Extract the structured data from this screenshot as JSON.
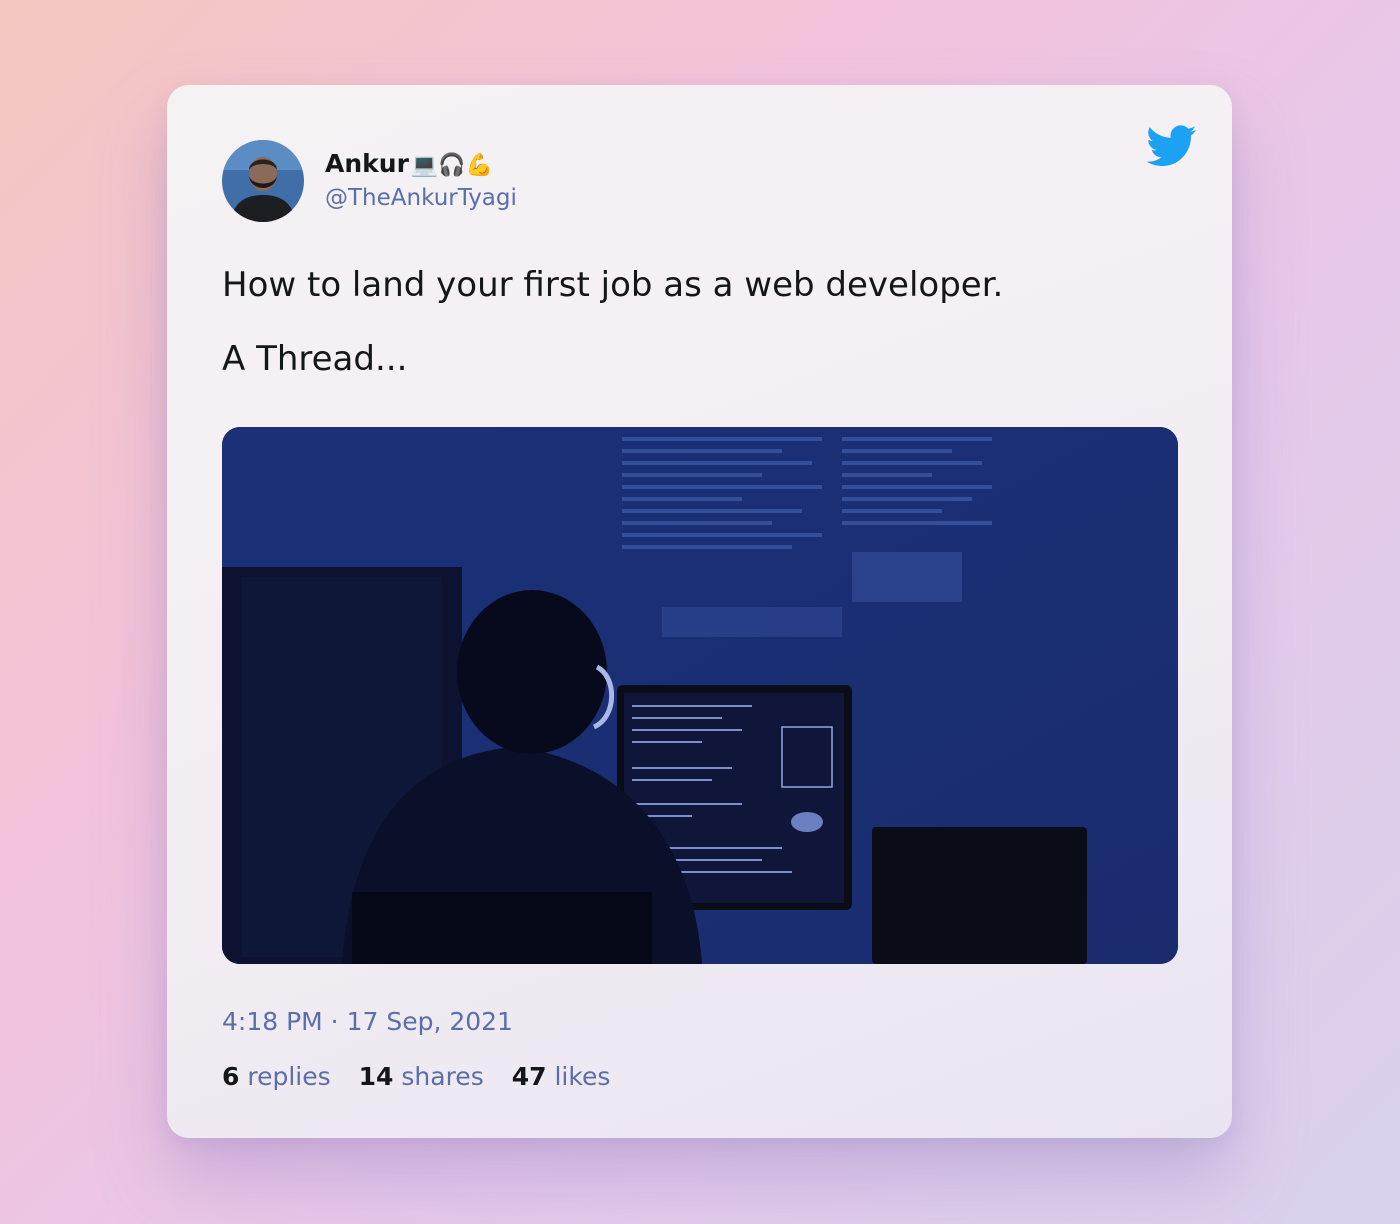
{
  "tweet": {
    "author_name": "Ankur",
    "author_emojis": "💻🎧💪",
    "author_handle": "@TheAnkurTyagi",
    "text_line_1": "How to land your first job as a web developer.",
    "text_line_2": "A Thread...",
    "timestamp": "4:18 PM · 17 Sep, 2021",
    "stats": {
      "replies_count": "6",
      "replies_label": "replies",
      "shares_count": "14",
      "shares_label": "shares",
      "likes_count": "47",
      "likes_label": "likes"
    }
  },
  "icons": {
    "brand": "twitter-bird-icon",
    "brand_color": "#1da1f2"
  },
  "colors": {
    "handle": "#5a6ea8",
    "text": "#14171a",
    "image_tint": "#1a2f74"
  }
}
